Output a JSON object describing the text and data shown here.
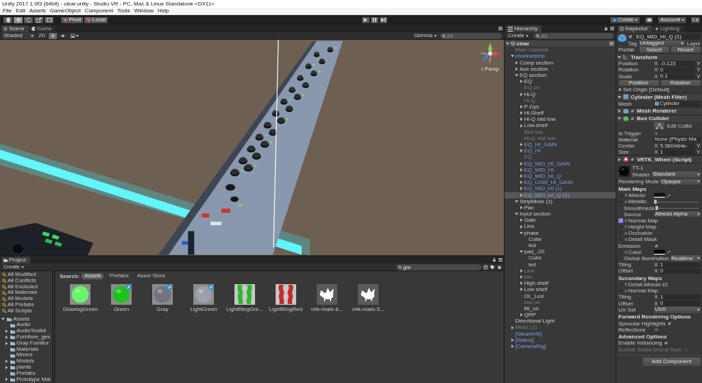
{
  "window": {
    "title": "Unity 2017.1.0f3 (64bit) - clear.unity - Studio VR - PC, Mac & Linux Standalone <DX11>"
  },
  "menu": [
    "File",
    "Edit",
    "Assets",
    "GameObject",
    "Component",
    "Tools",
    "Window",
    "Help"
  ],
  "toolbar": {
    "tools": [
      {
        "kind": "hand",
        "selected": false
      },
      {
        "kind": "move",
        "selected": true
      },
      {
        "kind": "rotate",
        "selected": false
      },
      {
        "kind": "scale",
        "selected": false
      },
      {
        "kind": "rect",
        "selected": false
      }
    ],
    "pivot": "Pivot",
    "space": "Local",
    "playback": [
      {
        "kind": "play",
        "selected": false
      },
      {
        "kind": "pause",
        "selected": false
      },
      {
        "kind": "step",
        "selected": false
      }
    ],
    "collab": "Collab",
    "account": "Account",
    "layers": "La"
  },
  "scene": {
    "tabs": [
      {
        "label": "Scene",
        "kind": "scene",
        "selected": true
      },
      {
        "label": "Game",
        "kind": "game",
        "selected": false
      }
    ],
    "shading": "Shaded",
    "mode_2d": "2D",
    "toggles": [
      {
        "kind": "lighting",
        "on": true
      },
      {
        "kind": "audio",
        "on": false
      },
      {
        "kind": "effects",
        "on": false
      }
    ],
    "gizmos": "Gizmos",
    "search": {
      "placeholder": "All"
    },
    "view_label": "Persp"
  },
  "project": {
    "tab": "Project",
    "create": "Create",
    "search": {
      "value": "gre"
    },
    "favorites": [
      {
        "label": "All Modified",
        "selected": false
      },
      {
        "label": "All Conflicts",
        "selected": false
      },
      {
        "label": "All Excluded",
        "selected": false
      },
      {
        "label": "All Materials",
        "selected": false
      },
      {
        "label": "All Models",
        "selected": false
      },
      {
        "label": "All Prefabs",
        "selected": false
      },
      {
        "label": "All Scripts",
        "selected": false
      }
    ],
    "folders": [
      {
        "label": "Assets",
        "expanded": true,
        "selected": false,
        "children": [
          {
            "label": "Audio",
            "selected": false
          },
          {
            "label": "AudioToolkit",
            "expanded": false,
            "selected": false
          },
          {
            "label": "Furniture_ges",
            "expanded": false,
            "selected": false
          },
          {
            "label": "Gray Furnitur",
            "expanded": false,
            "selected": false
          },
          {
            "label": "Materials",
            "selected": false
          },
          {
            "label": "Mixers",
            "selected": false
          },
          {
            "label": "Models",
            "expanded": false,
            "selected": false
          },
          {
            "label": "plants",
            "expanded": false,
            "selected": false
          },
          {
            "label": "Prefabs",
            "selected": false
          },
          {
            "label": "Prototype Mat",
            "expanded": false,
            "selected": false
          }
        ]
      }
    ],
    "search_label": "Search:",
    "scopes": [
      {
        "label": "Assets",
        "selected": true
      },
      {
        "label": "'Prefabs'",
        "selected": false
      },
      {
        "label": "Asset Store",
        "selected": false
      }
    ],
    "assets": [
      {
        "name": "GlowingGreen",
        "kind": "material",
        "color": "#6cf36c",
        "badge": false,
        "selected": false
      },
      {
        "name": "Green",
        "kind": "material",
        "color": "#1fc21f",
        "badge": true,
        "selected": false
      },
      {
        "name": "Gray",
        "kind": "material",
        "color": "#6f7480",
        "badge": true,
        "selected": false
      },
      {
        "name": "LightGreen",
        "kind": "material",
        "color": "#9aa0ad",
        "badge": true,
        "selected": false
      },
      {
        "name": "LightRingGre...",
        "kind": "ring",
        "color": "#2fb52f",
        "badge": false,
        "selected": false
      },
      {
        "name": "LightRingRed",
        "kind": "ring",
        "color": "#c42a2a",
        "badge": false,
        "selected": false
      },
      {
        "name": "vrtk-mark-6...",
        "kind": "logo",
        "badge": false,
        "selected": false
      },
      {
        "name": "vrtk-mark-5...",
        "kind": "logo",
        "badge": false,
        "selected": false
      }
    ]
  },
  "hierarchy": {
    "tab": "Hierarchy",
    "create": "Create",
    "search": {
      "placeholder": "All"
    },
    "items": [
      {
        "label": "clear",
        "kind": "scene",
        "active": true,
        "expanded": true,
        "selected": false,
        "children": [
          {
            "label": "Main Camera",
            "kind": "object",
            "active": false,
            "selected": false
          },
          {
            "label": "channelstrip",
            "kind": "prefab",
            "active": true,
            "expanded": true,
            "selected": false,
            "children": [
              {
                "label": "Comp section",
                "kind": "object",
                "active": true,
                "expanded": false,
                "selected": false
              },
              {
                "label": "Aux section",
                "kind": "object",
                "active": true,
                "expanded": false,
                "selected": false
              },
              {
                "label": "EQ section",
                "kind": "object",
                "active": true,
                "expanded": true,
                "selected": false,
                "children": [
                  {
                    "label": "EQ",
                    "kind": "object",
                    "active": true,
                    "expanded": false,
                    "selected": false
                  },
                  {
                    "label": "EQ on",
                    "kind": "object",
                    "active": false,
                    "selected": false
                  },
                  {
                    "label": "Hi-Q",
                    "kind": "object",
                    "active": true,
                    "expanded": false,
                    "selected": false
                  },
                  {
                    "label": "Hi-Q",
                    "kind": "object",
                    "active": false,
                    "selected": false
                  },
                  {
                    "label": "P-Dys",
                    "kind": "object",
                    "active": true,
                    "expanded": false,
                    "selected": false
                  },
                  {
                    "label": "Hi-Shelf",
                    "kind": "object",
                    "active": true,
                    "expanded": false,
                    "selected": false
                  },
                  {
                    "label": "Hi-Q mid low",
                    "kind": "object",
                    "active": true,
                    "expanded": false,
                    "selected": false
                  },
                  {
                    "label": "Low-shelf",
                    "kind": "object",
                    "active": true,
                    "expanded": false,
                    "selected": false
                  },
                  {
                    "label": "Bell low",
                    "kind": "object",
                    "active": false,
                    "selected": false
                  },
                  {
                    "label": "Hi-Q mid low",
                    "kind": "object",
                    "active": false,
                    "selected": false
                  },
                  {
                    "label": "EQ_HI_GAIN",
                    "kind": "prefab",
                    "active": true,
                    "expanded": false,
                    "selected": false
                  },
                  {
                    "label": "EQ_HI",
                    "kind": "prefab",
                    "active": true,
                    "expanded": false,
                    "selected": false
                  },
                  {
                    "label": "EQ",
                    "kind": "object",
                    "active": false,
                    "selected": false
                  },
                  {
                    "label": "EQ_MID_HI_GAIN",
                    "kind": "prefab",
                    "active": true,
                    "expanded": false,
                    "selected": false
                  },
                  {
                    "label": "EQ_MID_HI",
                    "kind": "prefab",
                    "active": true,
                    "expanded": false,
                    "selected": false
                  },
                  {
                    "label": "EQ_MID_HI_Q",
                    "kind": "prefab",
                    "active": true,
                    "expanded": false,
                    "selected": false
                  },
                  {
                    "label": "EQ_LOW_HI_GAIN",
                    "kind": "prefab",
                    "active": true,
                    "expanded": false,
                    "selected": false
                  },
                  {
                    "label": "EQ_MID_HI (1)",
                    "kind": "prefab",
                    "active": true,
                    "expanded": false,
                    "selected": false
                  },
                  {
                    "label": "EQ_MID_HI_Q (1)",
                    "kind": "prefab",
                    "active": true,
                    "expanded": false,
                    "selected": true
                  }
                ]
              },
              {
                "label": "StripMixer (1)",
                "kind": "object",
                "active": true,
                "expanded": true,
                "selected": false,
                "children": [
                  {
                    "label": "Pan",
                    "kind": "object",
                    "active": true,
                    "expanded": false,
                    "selected": false
                  }
                ]
              },
              {
                "label": "Input section",
                "kind": "object",
                "active": true,
                "expanded": true,
                "selected": false,
                "children": [
                  {
                    "label": "Gain",
                    "kind": "object",
                    "active": true,
                    "expanded": false,
                    "selected": false
                  },
                  {
                    "label": "Line",
                    "kind": "object",
                    "active": true,
                    "expanded": false,
                    "selected": false
                  },
                  {
                    "label": "phase",
                    "kind": "object",
                    "active": true,
                    "expanded": true,
                    "selected": false,
                    "children": [
                      {
                        "label": "Cube",
                        "kind": "object",
                        "active": true,
                        "selected": false
                      },
                      {
                        "label": "led",
                        "kind": "object",
                        "active": true,
                        "selected": false
                      }
                    ]
                  },
                  {
                    "label": "pad_-20",
                    "kind": "object",
                    "active": true,
                    "expanded": true,
                    "selected": false,
                    "children": [
                      {
                        "label": "Cube",
                        "kind": "object",
                        "active": true,
                        "selected": false
                      },
                      {
                        "label": "led",
                        "kind": "object",
                        "active": true,
                        "selected": false
                      }
                    ]
                  },
                  {
                    "label": "Line",
                    "kind": "object",
                    "active": false,
                    "expanded": false,
                    "selected": false
                  },
                  {
                    "label": "Mic",
                    "kind": "object",
                    "active": false,
                    "expanded": false,
                    "selected": false
                  },
                  {
                    "label": "High shelf",
                    "kind": "object",
                    "active": true,
                    "expanded": false,
                    "selected": false
                  },
                  {
                    "label": "Low shelf",
                    "kind": "object",
                    "active": true,
                    "expanded": false,
                    "selected": false
                  },
                  {
                    "label": "OL_Led",
                    "kind": "object",
                    "active": true,
                    "selected": false
                  },
                  {
                    "label": "low on",
                    "kind": "object",
                    "active": false,
                    "selected": false
                  },
                  {
                    "label": "filt_on",
                    "kind": "object",
                    "active": true,
                    "selected": false
                  },
                  {
                    "label": "QRP",
                    "kind": "object",
                    "active": true,
                    "expanded": false,
                    "selected": false
                  }
                ]
              }
            ]
          },
          {
            "label": "Directional Light",
            "kind": "object",
            "active": true,
            "selected": false
          },
          {
            "label": "Mixer (1)",
            "kind": "object",
            "active": false,
            "expanded": false,
            "selected": false
          },
          {
            "label": "[SteamVR]",
            "kind": "prefab",
            "active": true,
            "selected": false
          },
          {
            "label": "[Status]",
            "kind": "prefab",
            "active": true,
            "expanded": false,
            "selected": false
          },
          {
            "label": "[CameraRig]",
            "kind": "prefab",
            "active": true,
            "expanded": false,
            "selected": false
          }
        ]
      }
    ]
  },
  "inspector": {
    "tabs": [
      {
        "label": "Inspector",
        "kind": "inspector",
        "selected": true
      },
      {
        "label": "Lighting",
        "kind": "lighting",
        "selected": false
      }
    ],
    "object": {
      "name": "EQ_MID_HI_Q (1)",
      "active": true,
      "tag_label": "Tag",
      "tag": "Untagged",
      "layer_label": "Layer",
      "prefab_label": "Prefab",
      "prefab_buttons": [
        "Select",
        "Revert"
      ]
    },
    "components": [
      {
        "kind": "transform",
        "title": "Transform",
        "expanded": true,
        "rows": [
          {
            "kind": "vector",
            "label": "Position",
            "axis": "X",
            "value": "-0.123",
            "next_axis": "Y"
          },
          {
            "kind": "vector",
            "label": "Rotation",
            "axis": "X",
            "value": "0",
            "next_axis": "Y"
          },
          {
            "kind": "vector",
            "label": "Scale",
            "axis": "X",
            "value": "0.1",
            "next_axis": "Y"
          },
          {
            "kind": "buttons",
            "buttons": [
              "Position",
              "Rotation"
            ]
          },
          {
            "kind": "foldout",
            "label": "Set Origin [Default]",
            "expanded": false
          }
        ]
      },
      {
        "kind": "mesh_filter",
        "title": "Cylinder (Mesh Filter)",
        "expanded": true,
        "rows": [
          {
            "kind": "object",
            "label": "Mesh",
            "value": "Cylinder",
            "assigned": true
          }
        ]
      },
      {
        "kind": "renderer",
        "title": "Mesh Renderer",
        "expanded": false,
        "enabled": true
      },
      {
        "kind": "collider",
        "title": "Box Collider",
        "expanded": true,
        "enabled": true,
        "rows": [
          {
            "kind": "tool",
            "label": "Edit Collid"
          },
          {
            "kind": "toggle",
            "label": "Is Trigger",
            "checked": false,
            "disabled": false
          },
          {
            "kind": "object",
            "label": "Material",
            "value": "None (Physic Ma",
            "assigned": false
          },
          {
            "kind": "vector",
            "label": "Center",
            "axis": "X",
            "value": "5.560464e-",
            "next_axis": "Y"
          },
          {
            "kind": "vector",
            "label": "Size",
            "axis": "X",
            "value": "1",
            "next_axis": "Y"
          }
        ]
      },
      {
        "kind": "script",
        "title": "VRTK_Wheel (Script)",
        "expanded": false,
        "enabled": true
      }
    ],
    "material": {
      "name": "TT-1",
      "shader_label": "Shader",
      "shader": "Standard",
      "rows": [
        {
          "kind": "dropdown",
          "label": "Rendering Mode",
          "value": "Opaque"
        },
        {
          "kind": "heading",
          "label": "Main Maps"
        },
        {
          "kind": "map",
          "label": "Albedo",
          "texture": false,
          "color": "#111111"
        },
        {
          "kind": "map",
          "label": "Metallic",
          "texture": false,
          "level": 0,
          "children": [
            {
              "kind": "slider",
              "label": "Smoothness",
              "level": 0
            },
            {
              "kind": "dropdown",
              "label": "Source",
              "value": "Albedo Alpha"
            }
          ]
        },
        {
          "kind": "map",
          "label": "Normal Map",
          "texture": true
        },
        {
          "kind": "map",
          "label": "Height Map",
          "texture": false
        },
        {
          "kind": "map",
          "label": "Occlusion",
          "texture": false
        },
        {
          "kind": "map",
          "label": "Detail Mask",
          "texture": false
        },
        {
          "kind": "toggle",
          "label": "Emission",
          "checked": true,
          "disabled": false
        },
        {
          "kind": "map",
          "label": "Color",
          "texture": false,
          "color": "#000000",
          "children": [
            {
              "kind": "dropdown",
              "label": "Global Illumination",
              "value": "Realtime"
            }
          ]
        },
        {
          "kind": "vector",
          "label": "Tiling",
          "axis": "X",
          "value": "1"
        },
        {
          "kind": "vector",
          "label": "Offset",
          "axis": "X",
          "value": "0"
        },
        {
          "kind": "heading",
          "label": "Secondary Maps"
        },
        {
          "kind": "map",
          "label": "Detail Albedo x2",
          "texture": false
        },
        {
          "kind": "map",
          "label": "Normal Map",
          "texture": false
        },
        {
          "kind": "vector",
          "label": "Tiling",
          "axis": "X",
          "value": "1"
        },
        {
          "kind": "vector",
          "label": "Offset",
          "axis": "X",
          "value": "0"
        },
        {
          "kind": "dropdown",
          "label": "UV Set",
          "value": "UV0"
        },
        {
          "kind": "heading",
          "label": "Forward Rendering Options"
        },
        {
          "kind": "toggle",
          "label": "Specular Highlights",
          "checked": true,
          "disabled": false
        },
        {
          "kind": "toggle",
          "label": "Reflections",
          "checked": false,
          "disabled": false
        },
        {
          "kind": "heading",
          "label": "Advanced Options"
        },
        {
          "kind": "toggle",
          "label": "Enable Instancing",
          "checked": true,
          "disabled": false
        },
        {
          "kind": "toggle",
          "label": "Double Sided Global Illum",
          "checked": false,
          "disabled": true
        }
      ]
    },
    "add_component": "Add Component"
  }
}
